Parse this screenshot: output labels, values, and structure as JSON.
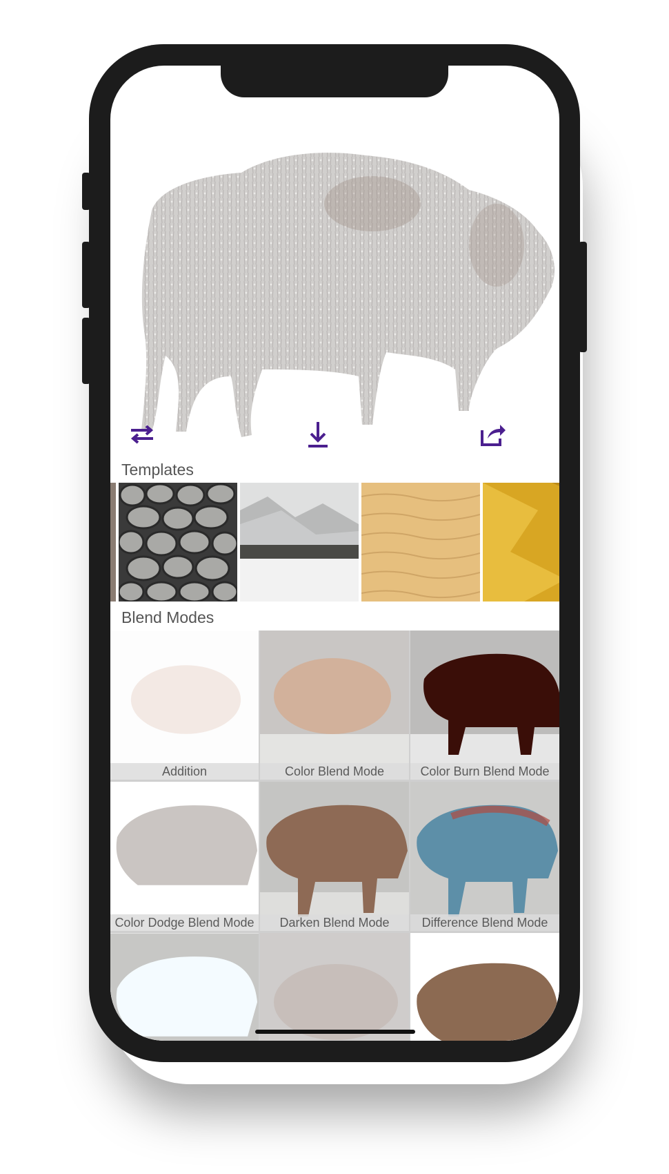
{
  "toolbar": {
    "swap_icon": "swap-arrows-icon",
    "download_icon": "download-icon",
    "share_icon": "share-icon",
    "accent_color": "#4b1f8f"
  },
  "templates": {
    "label": "Templates",
    "items": [
      "stone",
      "snow-valley",
      "sand",
      "gold"
    ],
    "selected": "snow-valley"
  },
  "blend_modes": {
    "label": "Blend Modes",
    "items": [
      {
        "label": "Addition"
      },
      {
        "label": "Color Blend Mode"
      },
      {
        "label": "Color Burn Blend Mode"
      },
      {
        "label": "Color Dodge Blend Mode"
      },
      {
        "label": "Darken Blend Mode"
      },
      {
        "label": "Difference Blend Mode"
      },
      {
        "label": ""
      },
      {
        "label": ""
      },
      {
        "label": ""
      }
    ]
  }
}
